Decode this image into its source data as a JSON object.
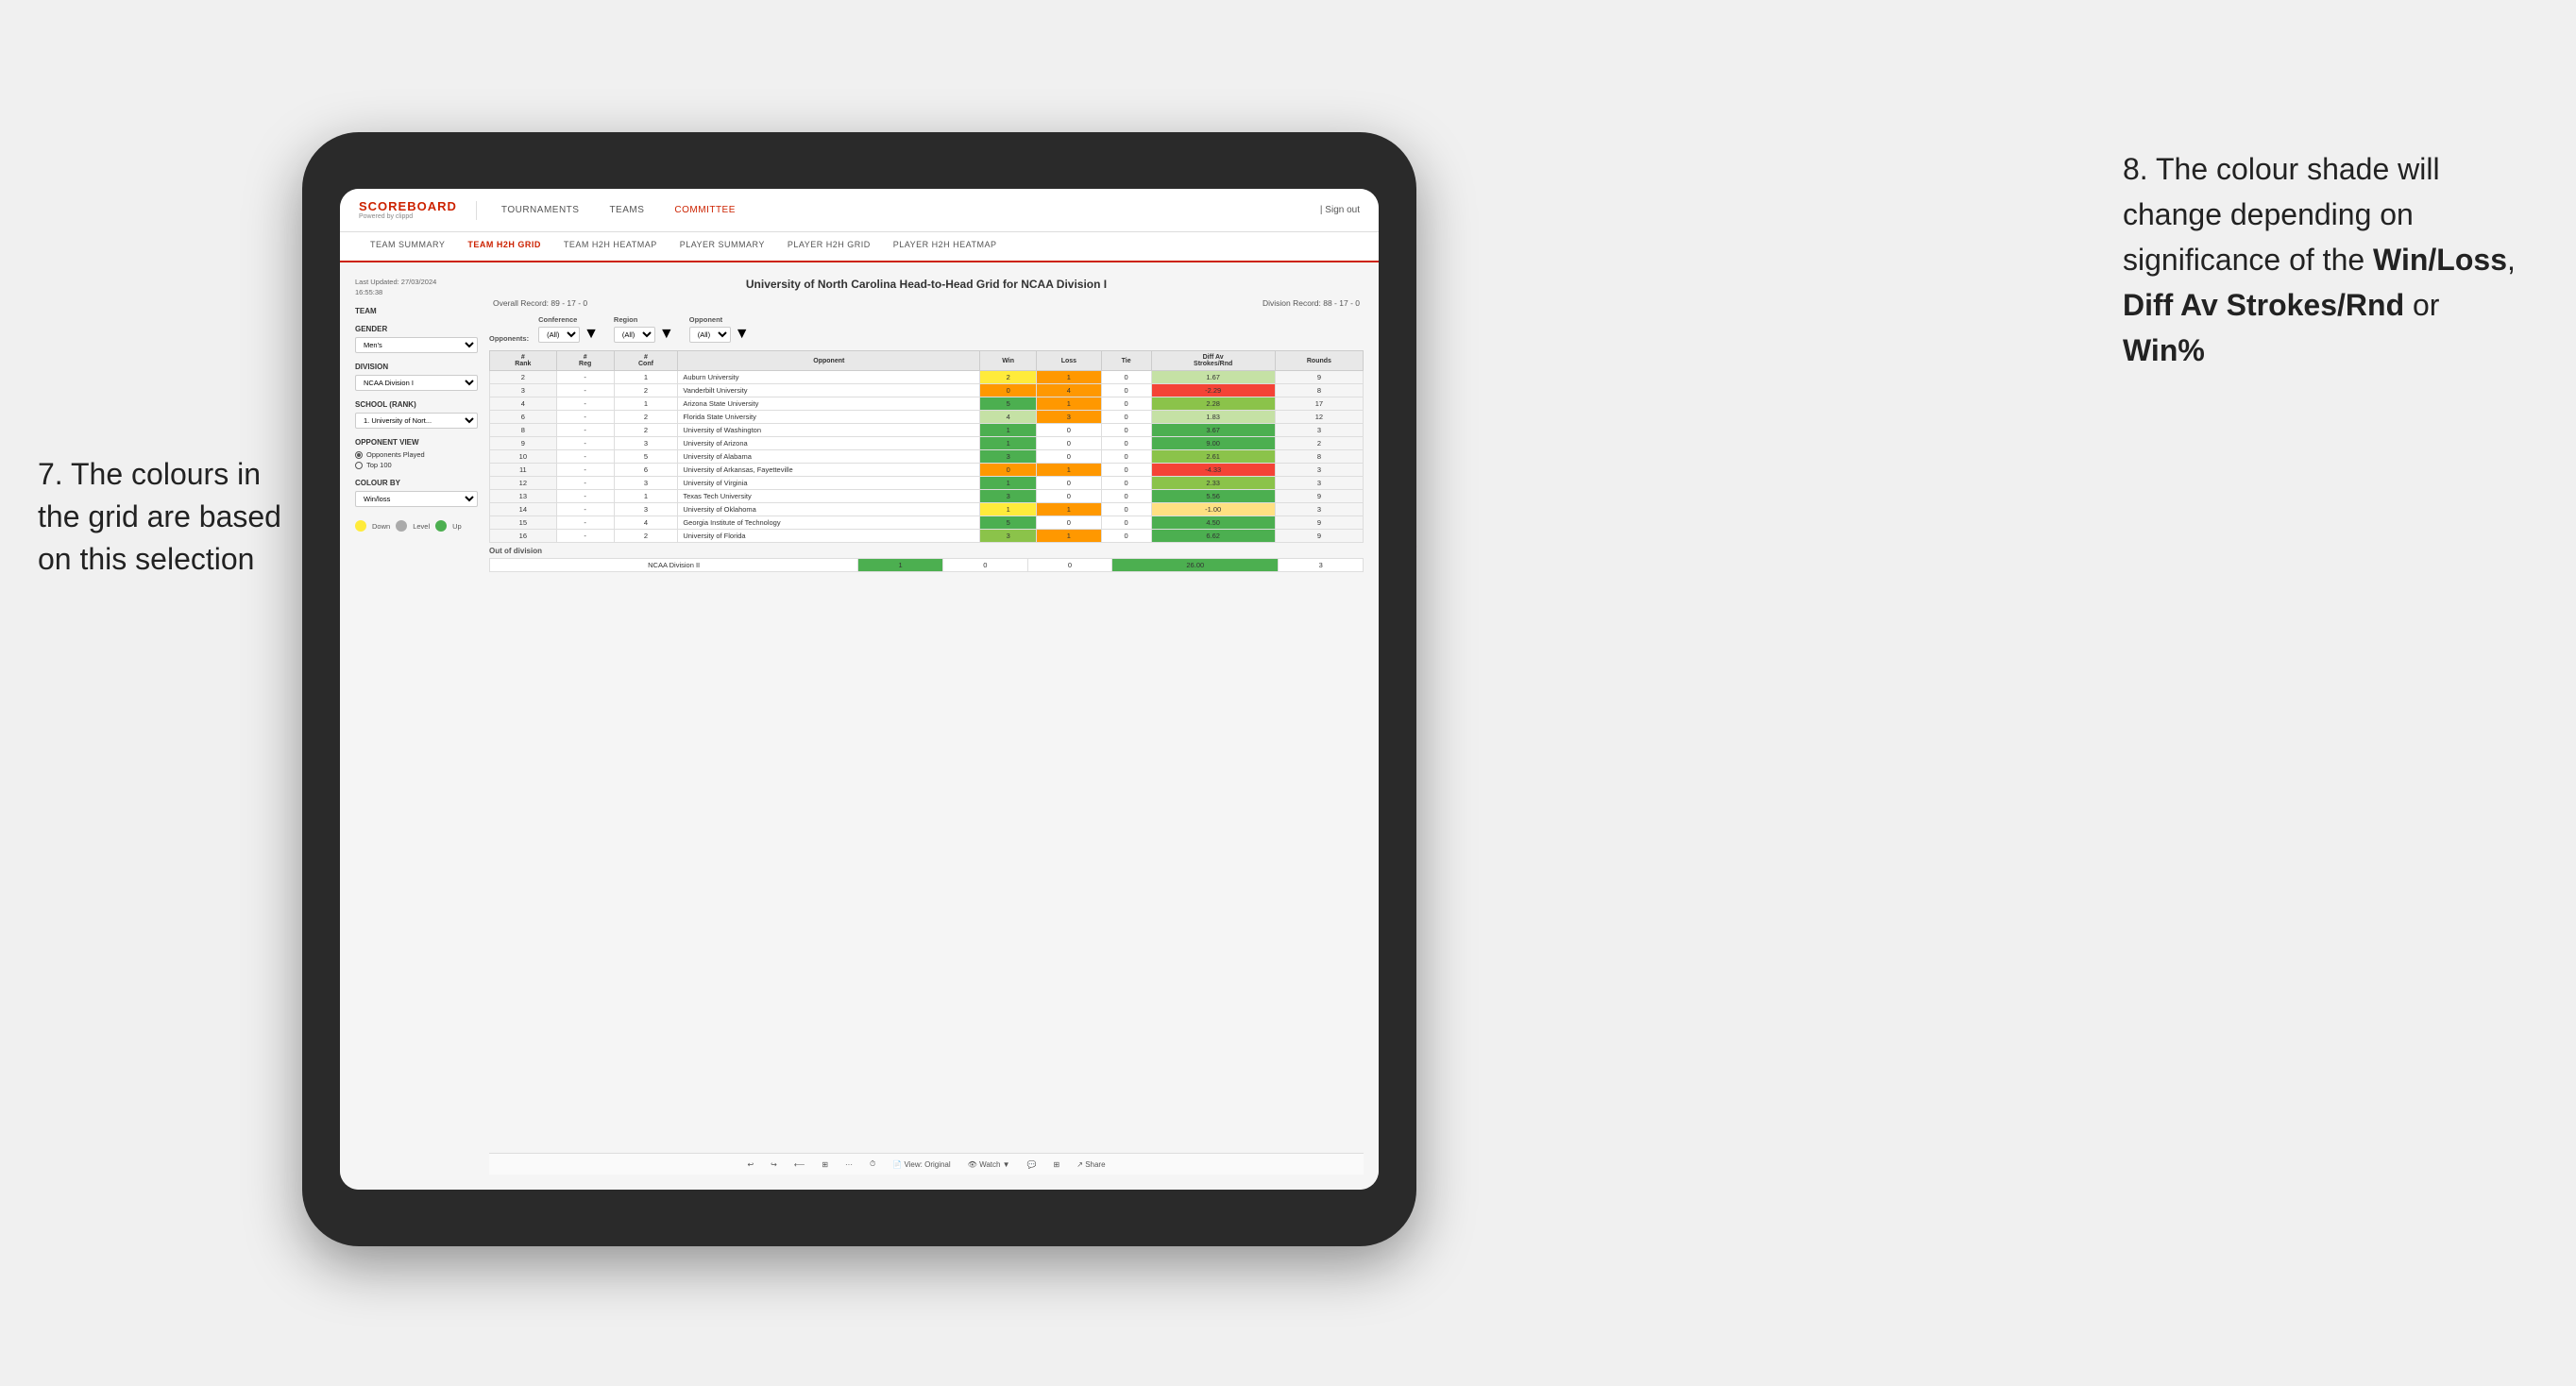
{
  "annotations": {
    "left_title": "7. The colours in the grid are based on this selection",
    "right_title_prefix": "8. The colour shade will change depending on significance of the ",
    "right_bold1": "Win/Loss",
    "right_bold2": "Diff Av Strokes/Rnd",
    "right_bold3": "Win%"
  },
  "navbar": {
    "logo": "SCOREBOARD",
    "logo_sub": "Powered by clippd",
    "nav_items": [
      "TOURNAMENTS",
      "TEAMS",
      "COMMITTEE"
    ],
    "sign_out": "Sign out"
  },
  "sub_navbar": {
    "items": [
      "TEAM SUMMARY",
      "TEAM H2H GRID",
      "TEAM H2H HEATMAP",
      "PLAYER SUMMARY",
      "PLAYER H2H GRID",
      "PLAYER H2H HEATMAP"
    ],
    "active": "TEAM H2H GRID"
  },
  "left_panel": {
    "last_updated_label": "Last Updated: 27/03/2024",
    "last_updated_time": "16:55:38",
    "team_label": "Team",
    "gender_label": "Gender",
    "gender_value": "Men's",
    "division_label": "Division",
    "division_value": "NCAA Division I",
    "school_label": "School (Rank)",
    "school_value": "1. University of Nort...",
    "opponent_view_label": "Opponent View",
    "opponents_played": "Opponents Played",
    "top100": "Top 100",
    "colour_by_label": "Colour by",
    "colour_by_value": "Win/loss",
    "legend": {
      "down": "Down",
      "level": "Level",
      "up": "Up"
    }
  },
  "grid": {
    "title": "University of North Carolina Head-to-Head Grid for NCAA Division I",
    "overall_record": "Overall Record: 89 - 17 - 0",
    "division_record": "Division Record: 88 - 17 - 0",
    "filters": {
      "conference_label": "Conference",
      "conference_value": "(All)",
      "region_label": "Region",
      "region_value": "(All)",
      "opponent_label": "Opponent",
      "opponent_value": "(All)",
      "opponents_label": "Opponents:"
    },
    "columns": [
      "#\nRank",
      "#\nReg",
      "#\nConf",
      "Opponent",
      "Win",
      "Loss",
      "Tie",
      "Diff Av\nStrokes/Rnd",
      "Rounds"
    ],
    "rows": [
      {
        "rank": "2",
        "reg": "-",
        "conf": "1",
        "opponent": "Auburn University",
        "win": "2",
        "loss": "1",
        "tie": "0",
        "diff": "1.67",
        "rounds": "9",
        "win_color": "yellow",
        "diff_color": "green_light"
      },
      {
        "rank": "3",
        "reg": "-",
        "conf": "2",
        "opponent": "Vanderbilt University",
        "win": "0",
        "loss": "4",
        "tie": "0",
        "diff": "-2.29",
        "rounds": "8",
        "win_color": "orange",
        "diff_color": "red"
      },
      {
        "rank": "4",
        "reg": "-",
        "conf": "1",
        "opponent": "Arizona State University",
        "win": "5",
        "loss": "1",
        "tie": "0",
        "diff": "2.28",
        "rounds": "17",
        "win_color": "green_dark",
        "diff_color": "green_med"
      },
      {
        "rank": "6",
        "reg": "-",
        "conf": "2",
        "opponent": "Florida State University",
        "win": "4",
        "loss": "3",
        "tie": "0",
        "diff": "1.83",
        "rounds": "12",
        "win_color": "green_light",
        "diff_color": "green_light"
      },
      {
        "rank": "8",
        "reg": "-",
        "conf": "2",
        "opponent": "University of Washington",
        "win": "1",
        "loss": "0",
        "tie": "0",
        "diff": "3.67",
        "rounds": "3",
        "win_color": "green_dark",
        "diff_color": "green_dark"
      },
      {
        "rank": "9",
        "reg": "-",
        "conf": "3",
        "opponent": "University of Arizona",
        "win": "1",
        "loss": "0",
        "tie": "0",
        "diff": "9.00",
        "rounds": "2",
        "win_color": "green_dark",
        "diff_color": "green_dark"
      },
      {
        "rank": "10",
        "reg": "-",
        "conf": "5",
        "opponent": "University of Alabama",
        "win": "3",
        "loss": "0",
        "tie": "0",
        "diff": "2.61",
        "rounds": "8",
        "win_color": "green_dark",
        "diff_color": "green_med"
      },
      {
        "rank": "11",
        "reg": "-",
        "conf": "6",
        "opponent": "University of Arkansas, Fayetteville",
        "win": "0",
        "loss": "1",
        "tie": "0",
        "diff": "-4.33",
        "rounds": "3",
        "win_color": "orange",
        "diff_color": "red"
      },
      {
        "rank": "12",
        "reg": "-",
        "conf": "3",
        "opponent": "University of Virginia",
        "win": "1",
        "loss": "0",
        "tie": "0",
        "diff": "2.33",
        "rounds": "3",
        "win_color": "green_dark",
        "diff_color": "green_med"
      },
      {
        "rank": "13",
        "reg": "-",
        "conf": "1",
        "opponent": "Texas Tech University",
        "win": "3",
        "loss": "0",
        "tie": "0",
        "diff": "5.56",
        "rounds": "9",
        "win_color": "green_dark",
        "diff_color": "green_dark"
      },
      {
        "rank": "14",
        "reg": "-",
        "conf": "3",
        "opponent": "University of Oklahoma",
        "win": "1",
        "loss": "1",
        "tie": "0",
        "diff": "-1.00",
        "rounds": "3",
        "win_color": "yellow",
        "diff_color": "orange_light"
      },
      {
        "rank": "15",
        "reg": "-",
        "conf": "4",
        "opponent": "Georgia Institute of Technology",
        "win": "5",
        "loss": "0",
        "tie": "0",
        "diff": "4.50",
        "rounds": "9",
        "win_color": "green_dark",
        "diff_color": "green_dark"
      },
      {
        "rank": "16",
        "reg": "-",
        "conf": "2",
        "opponent": "University of Florida",
        "win": "3",
        "loss": "1",
        "tie": "0",
        "diff": "6.62",
        "rounds": "9",
        "win_color": "green_med",
        "diff_color": "green_dark"
      }
    ],
    "out_of_division_label": "Out of division",
    "out_of_division_rows": [
      {
        "division": "NCAA Division II",
        "win": "1",
        "loss": "0",
        "tie": "0",
        "diff": "26.00",
        "rounds": "3",
        "win_color": "green_dark",
        "diff_color": "green_dark"
      }
    ]
  },
  "toolbar": {
    "view_label": "View: Original",
    "watch_label": "Watch",
    "share_label": "Share"
  }
}
